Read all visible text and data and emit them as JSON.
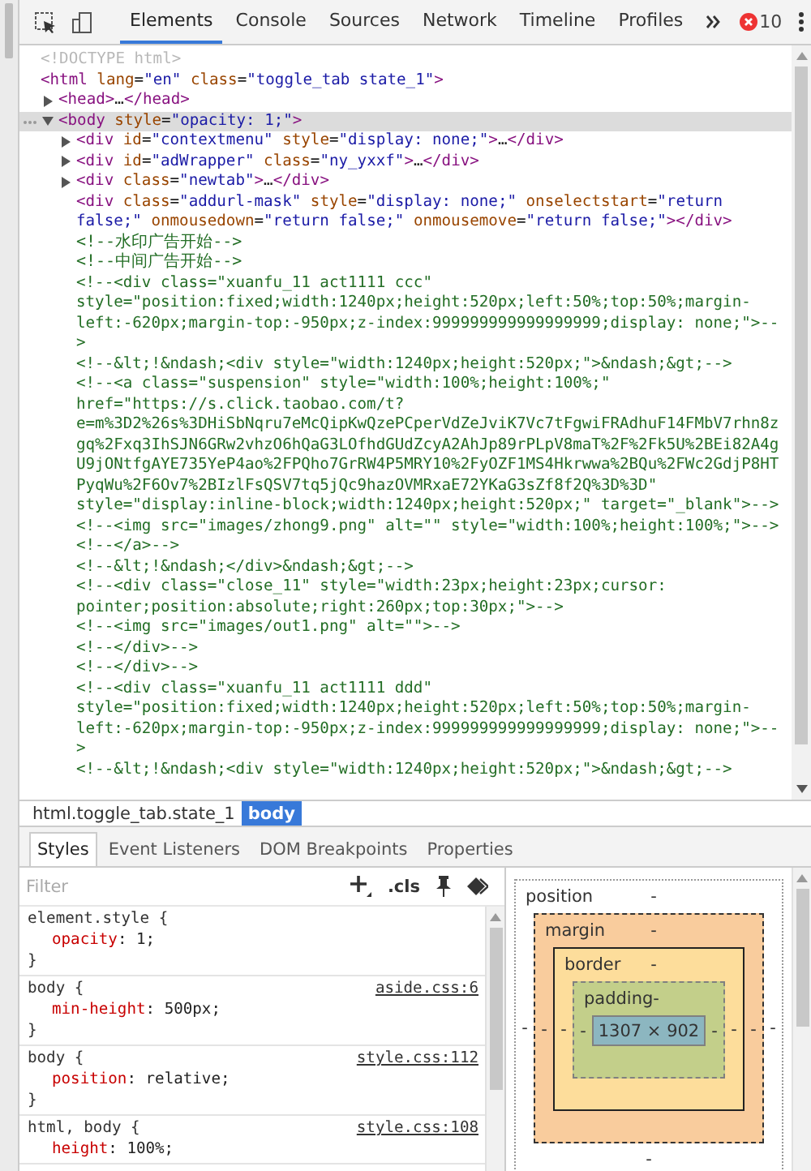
{
  "toolbar": {
    "tabs": [
      {
        "label": "Elements",
        "selected": true
      },
      {
        "label": "Console",
        "selected": false
      },
      {
        "label": "Sources",
        "selected": false
      },
      {
        "label": "Network",
        "selected": false
      },
      {
        "label": "Timeline",
        "selected": false
      },
      {
        "label": "Profiles",
        "selected": false
      }
    ],
    "error_count": "10"
  },
  "dom_tree": [
    {
      "kind": "doctype",
      "selected": false,
      "lines": [
        "<!DOCTYPE html>"
      ]
    },
    {
      "kind": "element",
      "selected": false,
      "lines": [
        [
          {
            "kind": "tag",
            "text": "<html"
          },
          {
            "kind": "attr",
            "text": " lang"
          },
          {
            "kind": "text",
            "text": "="
          },
          {
            "kind": "value",
            "text": "\"en\""
          },
          {
            "kind": "attr",
            "text": " class"
          },
          {
            "kind": "text",
            "text": "="
          },
          {
            "kind": "value",
            "text": "\"toggle_tab state_1\""
          },
          {
            "kind": "tag",
            "text": ">"
          }
        ]
      ],
      "children": [
        {
          "kind": "element",
          "expanded": false,
          "selected": false,
          "lines": [
            [
              {
                "kind": "tag",
                "text": "<head>"
              },
              {
                "kind": "text",
                "text": "…"
              },
              {
                "kind": "tag",
                "text": "</head>"
              }
            ]
          ]
        },
        {
          "kind": "element",
          "expanded": true,
          "selected": true,
          "lines": [
            [
              {
                "kind": "tag",
                "text": "<body"
              },
              {
                "kind": "attr",
                "text": " style"
              },
              {
                "kind": "text",
                "text": "="
              },
              {
                "kind": "value",
                "text": "\"opacity: 1;\""
              },
              {
                "kind": "tag",
                "text": ">"
              }
            ]
          ],
          "children": [
            {
              "kind": "element",
              "expanded": false,
              "selected": false,
              "lines": [
                [
                  {
                    "kind": "tag",
                    "text": "<div"
                  },
                  {
                    "kind": "attr",
                    "text": " id"
                  },
                  {
                    "kind": "text",
                    "text": "="
                  },
                  {
                    "kind": "value",
                    "text": "\"contextmenu\""
                  },
                  {
                    "kind": "attr",
                    "text": " style"
                  },
                  {
                    "kind": "text",
                    "text": "="
                  },
                  {
                    "kind": "value",
                    "text": "\"display: none;\""
                  },
                  {
                    "kind": "tag",
                    "text": ">"
                  },
                  {
                    "kind": "text",
                    "text": "…"
                  },
                  {
                    "kind": "tag",
                    "text": "</div>"
                  }
                ]
              ]
            },
            {
              "kind": "element",
              "expanded": false,
              "selected": false,
              "lines": [
                [
                  {
                    "kind": "tag",
                    "text": "<div"
                  },
                  {
                    "kind": "attr",
                    "text": " id"
                  },
                  {
                    "kind": "text",
                    "text": "="
                  },
                  {
                    "kind": "value",
                    "text": "\"adWrapper\""
                  },
                  {
                    "kind": "attr",
                    "text": " class"
                  },
                  {
                    "kind": "text",
                    "text": "="
                  },
                  {
                    "kind": "value",
                    "text": "\"ny_yxxf\""
                  },
                  {
                    "kind": "tag",
                    "text": ">"
                  },
                  {
                    "kind": "text",
                    "text": "…"
                  },
                  {
                    "kind": "tag",
                    "text": "</div>"
                  }
                ]
              ]
            },
            {
              "kind": "element",
              "expanded": false,
              "selected": false,
              "lines": [
                [
                  {
                    "kind": "tag",
                    "text": "<div"
                  },
                  {
                    "kind": "attr",
                    "text": " class"
                  },
                  {
                    "kind": "text",
                    "text": "="
                  },
                  {
                    "kind": "value",
                    "text": "\"newtab\""
                  },
                  {
                    "kind": "tag",
                    "text": ">"
                  },
                  {
                    "kind": "text",
                    "text": "…"
                  },
                  {
                    "kind": "tag",
                    "text": "</div>"
                  }
                ]
              ]
            },
            {
              "kind": "element",
              "selected": false,
              "lines": [
                [
                  {
                    "kind": "tag",
                    "text": "<div"
                  },
                  {
                    "kind": "attr",
                    "text": " class"
                  },
                  {
                    "kind": "text",
                    "text": "="
                  },
                  {
                    "kind": "value",
                    "text": "\"addurl-mask\""
                  },
                  {
                    "kind": "attr",
                    "text": " style"
                  },
                  {
                    "kind": "text",
                    "text": "="
                  },
                  {
                    "kind": "value",
                    "text": "\"display: none;\""
                  },
                  {
                    "kind": "attr",
                    "text": " onselectstart"
                  },
                  {
                    "kind": "text",
                    "text": "="
                  },
                  {
                    "kind": "value",
                    "text": "\"return"
                  }
                ],
                [
                  {
                    "kind": "value",
                    "text": "false;\""
                  },
                  {
                    "kind": "attr",
                    "text": " onmousedown"
                  },
                  {
                    "kind": "text",
                    "text": "="
                  },
                  {
                    "kind": "value",
                    "text": "\"return false;\""
                  },
                  {
                    "kind": "attr",
                    "text": " onmousemove"
                  },
                  {
                    "kind": "text",
                    "text": "="
                  },
                  {
                    "kind": "value",
                    "text": "\"return false;\""
                  },
                  {
                    "kind": "tag",
                    "text": "></div>"
                  }
                ]
              ]
            },
            {
              "kind": "comment",
              "selected": false,
              "lines": [
                "<!--水印广告开始-->"
              ]
            },
            {
              "kind": "comment",
              "selected": false,
              "lines": [
                "<!--中间广告开始-->"
              ]
            },
            {
              "kind": "comment",
              "selected": false,
              "lines": [
                "<!--<div class=\"xuanfu_11 act1111 ccc\"",
                "style=\"position:fixed;width:1240px;height:520px;left:50%;top:50%;margin-",
                "left:-620px;margin-top:-950px;z-index:999999999999999999;display: none;\">--",
                ">"
              ]
            },
            {
              "kind": "comment",
              "selected": false,
              "lines": [
                "<!--&lt;!&ndash;<div style=\"width:1240px;height:520px;\">&ndash;&gt;-->"
              ]
            },
            {
              "kind": "comment",
              "selected": false,
              "lines": [
                "<!--<a class=\"suspension\" style=\"width:100%;height:100%;\"",
                "href=\"https://s.click.taobao.com/t?",
                "e=m%3D2%26s%3DHiSbNqru7eMcQipKwQzePCperVdZeJviK7Vc7tFgwiFRAdhuF14FMbV7rhn8z",
                "gq%2Fxq3IhSJN6GRw2vhzO6hQaG3LOfhdGUdZcyA2AhJp89rPLpV8maT%2F%2Fk5U%2BEi82A4g",
                "U9jONtfgAYE735YeP4ao%2FPQho7GrRW4P5MRY10%2FyOZF1MS4Hkrwwa%2BQu%2FWc2GdjP8HT",
                "PyqWu%2F6Ov7%2BIzlFsQSV7tq5jQc9hazOVMRxaE72YKaG3sZf8f2Q%3D%3D\"",
                "style=\"display:inline-block;width:1240px;height:520px;\" target=\"_blank\">-->"
              ]
            },
            {
              "kind": "comment",
              "selected": false,
              "lines": [
                "<!--<img src=\"images/zhong9.png\" alt=\"\" style=\"width:100%;height:100%;\">-->"
              ]
            },
            {
              "kind": "comment",
              "selected": false,
              "lines": [
                "<!--</a>-->"
              ]
            },
            {
              "kind": "comment",
              "selected": false,
              "lines": [
                "<!--&lt;!&ndash;</div>&ndash;&gt;-->"
              ]
            },
            {
              "kind": "comment",
              "selected": false,
              "lines": [
                "<!--<div class=\"close_11\" style=\"width:23px;height:23px;cursor:",
                "pointer;position:absolute;right:260px;top:30px;\">-->"
              ]
            },
            {
              "kind": "comment",
              "selected": false,
              "lines": [
                "<!--<img src=\"images/out1.png\" alt=\"\">-->"
              ]
            },
            {
              "kind": "comment",
              "selected": false,
              "lines": [
                "<!--</div>-->"
              ]
            },
            {
              "kind": "comment",
              "selected": false,
              "lines": [
                "<!--</div>-->"
              ]
            },
            {
              "kind": "comment",
              "selected": false,
              "lines": [
                "<!--<div class=\"xuanfu_11 act1111 ddd\"",
                "style=\"position:fixed;width:1240px;height:520px;left:50%;top:50%;margin-",
                "left:-620px;margin-top:-950px;z-index:999999999999999999;display: none;\">--",
                ">"
              ]
            },
            {
              "kind": "comment",
              "selected": false,
              "lines": [
                "<!--&lt;!&ndash;<div style=\"width:1240px;height:520px;\">&ndash;&gt;-->"
              ]
            }
          ]
        }
      ]
    }
  ],
  "breadcrumbs": [
    {
      "label": "html.toggle_tab.state_1",
      "selected": false
    },
    {
      "label": "body",
      "selected": true
    }
  ],
  "sidebar_tabs": [
    {
      "label": "Styles",
      "selected": true
    },
    {
      "label": "Event Listeners",
      "selected": false
    },
    {
      "label": "DOM Breakpoints",
      "selected": false
    },
    {
      "label": "Properties",
      "selected": false
    }
  ],
  "styles": {
    "filter_placeholder": "Filter",
    "cls_button": ".cls",
    "rules": [
      {
        "selector": "element.style {",
        "declarations": [
          {
            "property": "opacity",
            "value": ": 1;"
          }
        ],
        "closing": "}"
      },
      {
        "selector": "body {",
        "source": "aside.css:6",
        "declarations": [
          {
            "property": "min-height",
            "value": ": 500px;"
          }
        ],
        "closing": "}"
      },
      {
        "selector": "body {",
        "source": "style.css:112",
        "declarations": [
          {
            "property": "position",
            "value": ": relative;"
          }
        ],
        "closing": "}"
      },
      {
        "selector": "html, body {",
        "source": "style.css:108",
        "declarations": [
          {
            "property": "height",
            "value": ": 100%;"
          }
        ]
      }
    ]
  },
  "box_model": {
    "layers": [
      {
        "kind": "position",
        "label": "position",
        "top": "-",
        "left": "-",
        "bottom": "-"
      },
      {
        "kind": "margin",
        "label": "margin",
        "top": "-",
        "left": "-"
      },
      {
        "kind": "border",
        "label": "border",
        "top": "-",
        "left": "-"
      },
      {
        "kind": "padding",
        "label": "padding",
        "top": "-",
        "left": "-"
      }
    ],
    "content": "1307 × 902",
    "right_side": [
      "-",
      "-",
      "-",
      "-"
    ]
  }
}
